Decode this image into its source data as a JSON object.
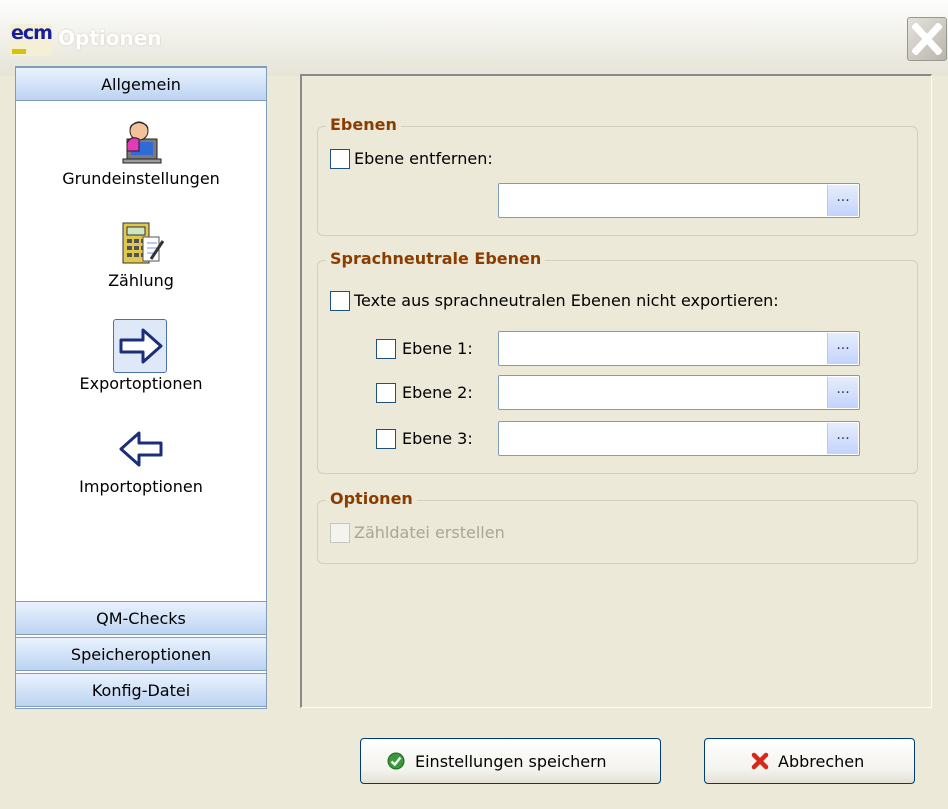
{
  "window": {
    "title": "Optionen",
    "logo_text": "ecm"
  },
  "nav": {
    "top_section": "Allgemein",
    "items": [
      {
        "label": "Grundeinstellungen",
        "icon": "user-computer-icon"
      },
      {
        "label": "Zählung",
        "icon": "calculator-icon"
      },
      {
        "label": "Exportoptionen",
        "icon": "export-arrow-icon",
        "selected": true
      },
      {
        "label": "Importoptionen",
        "icon": "import-arrow-icon"
      }
    ],
    "bottom_sections": [
      "QM-Checks",
      "Speicheroptionen",
      "Konfig-Datei"
    ]
  },
  "groups": {
    "ebenen": {
      "title": "Ebenen",
      "checkbox_label": "Ebene entfernen:",
      "checked": false,
      "field_value": "",
      "browse_label": "..."
    },
    "sprachneutral": {
      "title": "Sprachneutrale Ebenen",
      "checkbox_label": "Texte aus sprachneutralen Ebenen nicht exportieren:",
      "checked": false,
      "rows": [
        {
          "label": "Ebene 1:",
          "value": "",
          "browse_label": "..."
        },
        {
          "label": "Ebene 2:",
          "value": "",
          "browse_label": "..."
        },
        {
          "label": "Ebene 3:",
          "value": "",
          "browse_label": "..."
        }
      ]
    },
    "optionen": {
      "title": "Optionen",
      "checkbox_label": "Zähldatei erstellen",
      "enabled": false
    }
  },
  "buttons": {
    "save": "Einstellungen speichern",
    "cancel": "Abbrechen"
  },
  "colors": {
    "group_title": "#8a3d00",
    "nav_header": "#cfe0f7",
    "dialog_bg": "#ece9d8"
  }
}
